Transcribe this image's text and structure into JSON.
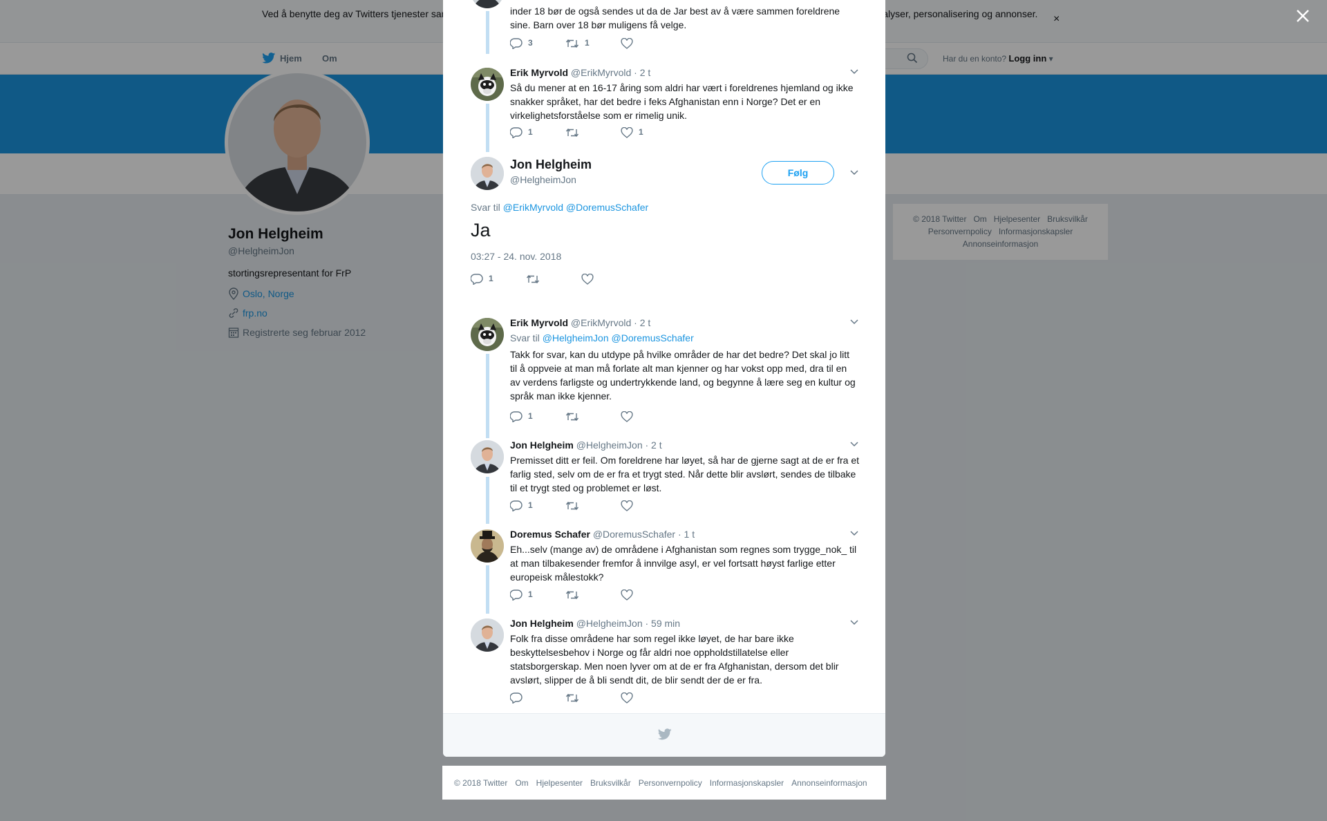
{
  "cookie": {
    "text": "Ved å benytte deg av Twitters tjenester samtykker du i vår bruk av informasjonskapsler. Vi og våre partnere bruker informasjonskapsler til bl.a. analyser, personalisering og annonser.",
    "close": "×"
  },
  "nav": {
    "home": "Hjem",
    "about": "Om",
    "login_prompt": "Har du en konto?",
    "login": "Logg inn"
  },
  "profile": {
    "name": "Jon Helgheim",
    "handle": "@HelgheimJon",
    "bio": "stortingsrepresentant for FrP",
    "location": "Oslo, Norge",
    "website": "frp.no",
    "joined": "Registrerte seg februar 2012"
  },
  "side_footer": [
    "© 2018 Twitter",
    "Om",
    "Hjelpesenter",
    "Bruksvilkår",
    "Personvernpolicy",
    "Informasjonskapsler",
    "Annonseinformasjon"
  ],
  "modal": {
    "top_partial": {
      "text": "inder 18 bør de også sendes ut da de Jar best av å være sammen foreldrene sine. Barn over 18 bør muligens få velge.",
      "replies": "3",
      "retweets": "1",
      "likes": ""
    },
    "tweet1": {
      "name": "Erik Myrvold",
      "handle": "@ErikMyrvold",
      "time": "· 2 t",
      "text": "Så du mener at en 16-17 åring som aldri har vært i foreldrenes hjemland og ikke snakker språket, har det bedre i feks Afghanistan enn i Norge? Det er en virkelighetsforståelse som er rimelig unik.",
      "replies": "1",
      "retweets": "",
      "likes": "1"
    },
    "main": {
      "name": "Jon Helgheim",
      "handle": "@HelgheimJon",
      "follow": "Følg",
      "reply_prefix": "Svar til",
      "reply_to_1": "@ErikMyrvold",
      "reply_to_2": "@DoremusSchafer",
      "text": "Ja",
      "date": "03:27 - 24. nov. 2018",
      "replies": "1",
      "retweets": "",
      "likes": ""
    },
    "replies": [
      {
        "name": "Erik Myrvold",
        "handle": "@ErikMyrvold",
        "time": "· 2 t",
        "reply_prefix": "Svar til",
        "reply_to_1": "@HelgheimJon",
        "reply_to_2": "@DoremusSchafer",
        "text": "Takk for svar, kan du utdype på hvilke områder de har det bedre? Det skal jo litt til å oppveie at man må forlate alt man kjenner og har vokst opp med, dra til en av verdens farligste og undertrykkende land, og begynne å lære seg en kultur og språk man ikke kjenner.",
        "replies": "1",
        "retweets": "",
        "likes": ""
      },
      {
        "name": "Jon Helgheim",
        "handle": "@HelgheimJon",
        "time": "· 2 t",
        "text": "Premisset ditt er feil. Om foreldrene har løyet, så har de gjerne sagt at de er fra et farlig sted, selv om de er fra et trygt sted. Når dette blir avslørt, sendes de tilbake til et trygt sted og problemet er løst.",
        "replies": "1",
        "retweets": "",
        "likes": ""
      },
      {
        "name": "Doremus Schafer",
        "handle": "@DoremusSchafer",
        "time": "· 1 t",
        "text": "Eh...selv (mange av) de områdene i Afghanistan som regnes som trygge_nok_ til at man tilbakesender fremfor å innvilge asyl, er vel fortsatt høyst farlige etter europeisk målestokk?",
        "replies": "1",
        "retweets": "",
        "likes": ""
      },
      {
        "name": "Jon Helgheim",
        "handle": "@HelgheimJon",
        "time": "· 59 min",
        "text": "Folk fra disse områdene har som regel ikke løyet, de har bare ikke beskyttelsesbehov i Norge og får aldri noe oppholdstillatelse eller statsborgerskap. Men noen lyver om at de er fra Afghanistan, dersom det blir avslørt, slipper de å bli sendt dit, de blir sendt der de er fra.",
        "replies": "",
        "retweets": "",
        "likes": ""
      }
    ]
  },
  "bottom_footer": [
    "© 2018 Twitter",
    "Om",
    "Hjelpesenter",
    "Bruksvilkår",
    "Personvernpolicy",
    "Informasjonskapsler",
    "Annonseinformasjon"
  ],
  "colors": {
    "brand": "#1da1f2",
    "banner": "#1b95e0",
    "muted": "#657786"
  }
}
